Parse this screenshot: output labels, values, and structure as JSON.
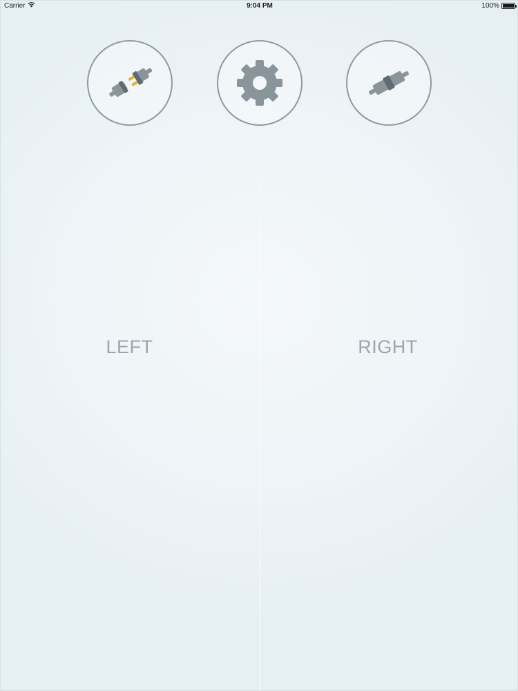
{
  "status_bar": {
    "carrier": "Carrier",
    "wifi_icon": "wifi-icon",
    "time": "9:04 PM",
    "battery_percent": "100%",
    "battery_level": 1.0
  },
  "toolbar": {
    "left_button_icon": "plug-disconnected-icon",
    "settings_button_icon": "gear-icon",
    "right_button_icon": "plug-connected-icon"
  },
  "zones": {
    "left_label": "LEFT",
    "right_label": "RIGHT"
  },
  "colors": {
    "icon_gray": "#8a959b",
    "icon_dark": "#5f6b70",
    "pin_gold": "#e0b23a",
    "ring": "#8e9aa0",
    "label": "#9aa6ac"
  }
}
